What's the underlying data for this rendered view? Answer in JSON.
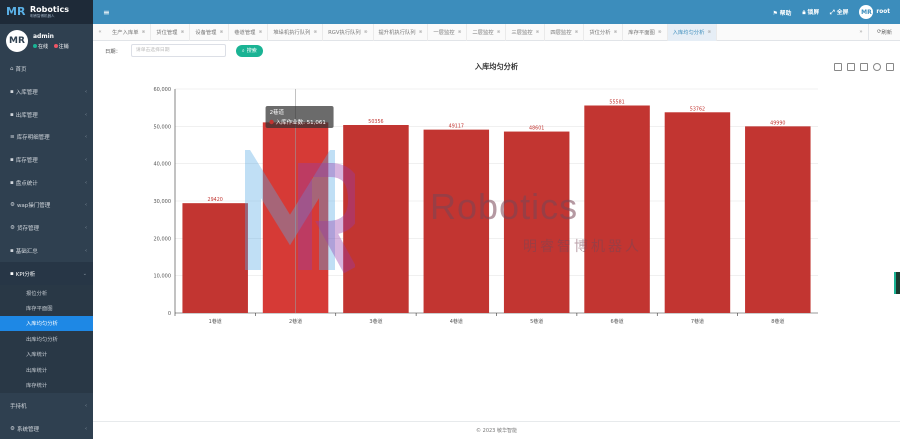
{
  "brand": {
    "title": "Robotics",
    "subtitle": "明睿智博机器人",
    "watermark_en": "Robotics",
    "watermark_cn": "明睿智博机器人"
  },
  "user": {
    "name": "admin",
    "online": "在线",
    "logout": "注销"
  },
  "sidebar": {
    "items": [
      {
        "label": "首页",
        "icon": "home-icon"
      },
      {
        "label": "入库管理",
        "icon": "folder-icon"
      },
      {
        "label": "出库管理",
        "icon": "folder-icon"
      },
      {
        "label": "库存明细管理",
        "icon": "list-icon"
      },
      {
        "label": "库存管理",
        "icon": "folder-icon"
      },
      {
        "label": "盘点统计",
        "icon": "folder-icon"
      },
      {
        "label": "wap操门管理",
        "icon": "gear-icon"
      },
      {
        "label": "货存管理",
        "icon": "gear-icon"
      },
      {
        "label": "基础汇总",
        "icon": "folder-icon"
      },
      {
        "label": "KPI分析",
        "icon": "folder-icon"
      }
    ],
    "kpi_sub": [
      "报位分析",
      "库存平面图",
      "入库均匀分析",
      "出库均匀分析",
      "入库统计",
      "出库统计",
      "库存统计"
    ],
    "bottom_items": [
      {
        "label": "手持机",
        "icon": "none"
      },
      {
        "label": "系统管理",
        "icon": "gear-icon"
      }
    ]
  },
  "topbar": {
    "help": "帮助",
    "lock": "锁屏",
    "fullscreen": "全屏",
    "user": "root"
  },
  "tabs": [
    "生产入库单",
    "货位管理",
    "设备管理",
    "巷道管理",
    "堆垛机执行队列",
    "RGV执行队列",
    "提升机执行队列",
    "一层监控",
    "二层监控",
    "三层监控",
    "四层监控",
    "货位分析",
    "库存平面图",
    "入库均匀分析"
  ],
  "tabs_refresh": "刷新",
  "filter": {
    "label": "日期：",
    "placeholder": "请单击选择日期",
    "search_label": "搜索"
  },
  "footer": "© 2023 敏华智能",
  "colors": {
    "bar": "#c23531",
    "bar_hover": "#d63a36",
    "sidebar": "#2f4050",
    "topbar": "#3c8dbc",
    "accent": "#1ab394"
  },
  "chart_data": {
    "type": "bar",
    "title": "入库均匀分析",
    "categories": [
      "1巷道",
      "2巷道",
      "3巷道",
      "4巷道",
      "5巷道",
      "6巷道",
      "7巷道",
      "8巷道"
    ],
    "series": [
      {
        "name": "入库作业数",
        "values": [
          29420,
          51061,
          50356,
          49117,
          48601,
          55581,
          53762,
          49990
        ]
      }
    ],
    "ylim": [
      0,
      60000
    ],
    "yticks": [
      0,
      10000,
      20000,
      30000,
      40000,
      50000,
      60000
    ],
    "ytick_labels": [
      "0",
      "10,000",
      "20,000",
      "30,000",
      "40,000",
      "50,000",
      "60,000"
    ],
    "data_labels": [
      "29420",
      "",
      "50356",
      "49117",
      "48601",
      "55581",
      "53762",
      "49990"
    ],
    "tooltip": {
      "category": "2巷道",
      "series": "入库作业数",
      "value_text": "51,061"
    },
    "grid": true
  }
}
